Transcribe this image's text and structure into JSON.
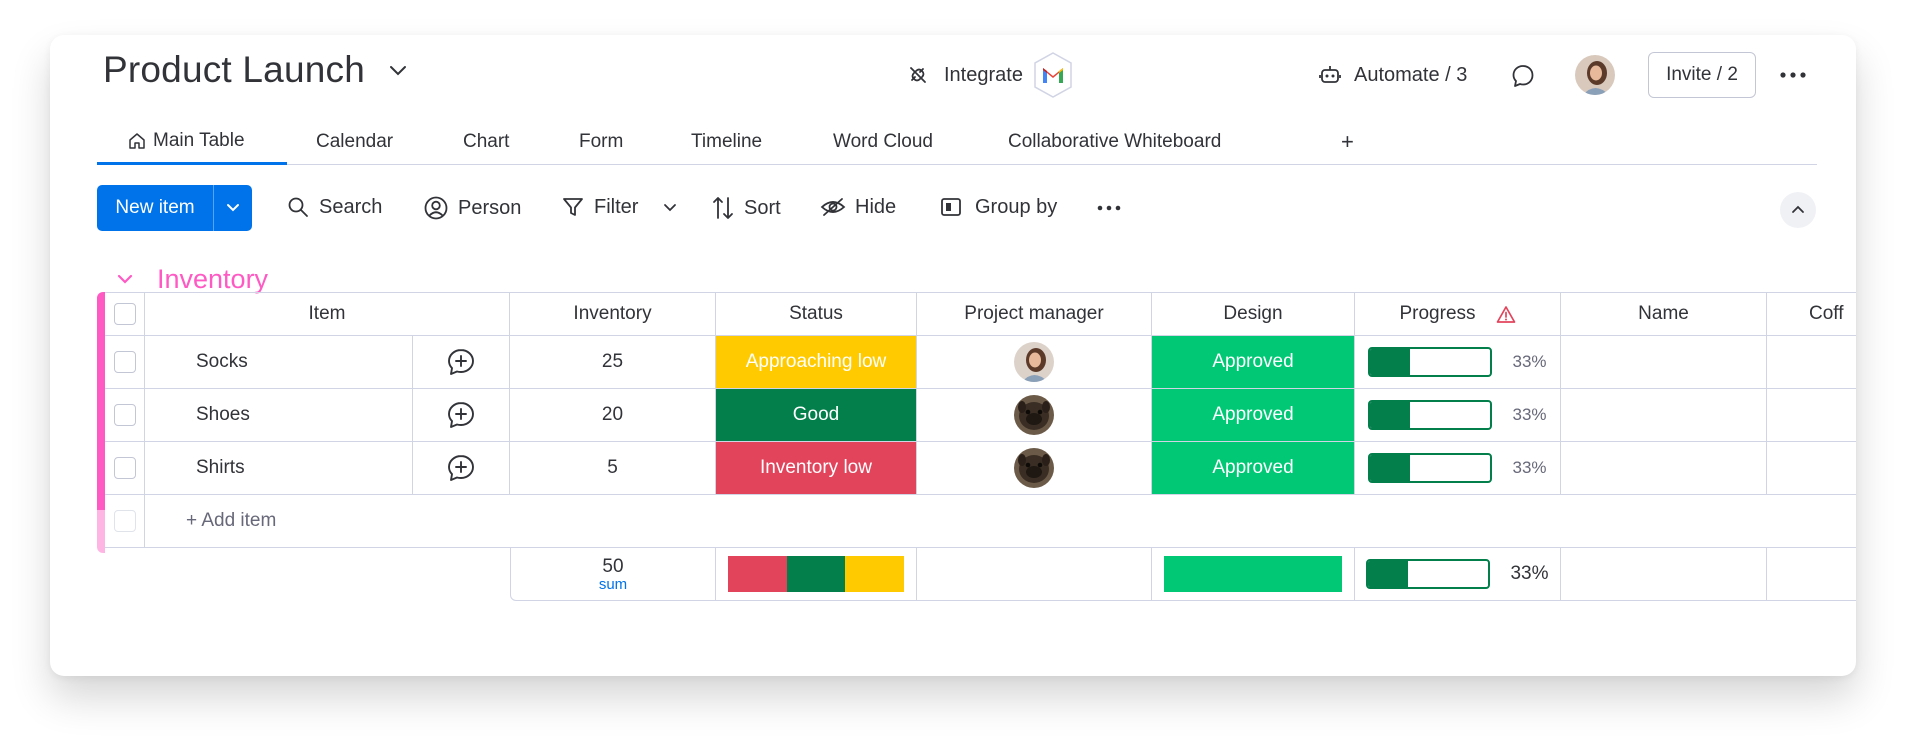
{
  "header": {
    "title": "Product Launch",
    "integrate_label": "Integrate",
    "automate_label": "Automate / 3",
    "invite_label": "Invite / 2"
  },
  "tabs": [
    {
      "label": "Main Table",
      "active": true
    },
    {
      "label": "Calendar"
    },
    {
      "label": "Chart"
    },
    {
      "label": "Form"
    },
    {
      "label": "Timeline"
    },
    {
      "label": "Word Cloud"
    },
    {
      "label": "Collaborative Whiteboard"
    },
    {
      "label": "+"
    }
  ],
  "toolbar": {
    "new_item_label": "New item",
    "search_label": "Search",
    "person_label": "Person",
    "filter_label": "Filter",
    "sort_label": "Sort",
    "hide_label": "Hide",
    "group_by_label": "Group by"
  },
  "group": {
    "title": "Inventory",
    "color": "#ff5ac4",
    "columns": [
      "Item",
      "Inventory",
      "Status",
      "Project manager",
      "Design",
      "Progress",
      "Name",
      "Coff"
    ],
    "rows": [
      {
        "item": "Socks",
        "inventory": "25",
        "status": "Approaching low",
        "status_color": "#ffcb00",
        "design": "Approved",
        "progress": "33%",
        "pm_avatar": "woman-avatar"
      },
      {
        "item": "Shoes",
        "inventory": "20",
        "status": "Good",
        "status_color": "#037f4c",
        "design": "Approved",
        "progress": "33%",
        "pm_avatar": "dog-avatar"
      },
      {
        "item": "Shirts",
        "inventory": "5",
        "status": "Inventory low",
        "status_color": "#e2445c",
        "design": "Approved",
        "progress": "33%",
        "pm_avatar": "dog-avatar"
      }
    ],
    "add_item_label": "+ Add item",
    "summary": {
      "inventory_total": "50",
      "inventory_func": "sum",
      "progress": "33%",
      "status_colors": [
        "#e2445c",
        "#037f4c",
        "#ffcb00"
      ],
      "design_color": "#00c875"
    }
  },
  "colors": {
    "accent": "#0073ea",
    "approved": "#00c875",
    "progress": "#037f4c",
    "warning": "#e2445c"
  }
}
